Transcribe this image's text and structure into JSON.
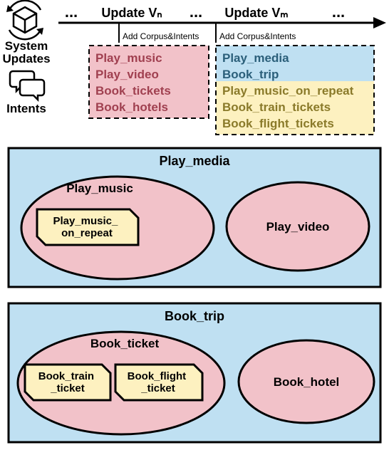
{
  "labels": {
    "system_updates": "System Updates",
    "intents": "Intents"
  },
  "timeline": {
    "dots1": "...",
    "update_n": "Update Vₙ",
    "dots2": "...",
    "update_m": "Update Vₘ",
    "dots3": "...",
    "tick_n": "Add Corpus&Intents",
    "tick_m": "Add Corpus&Intents"
  },
  "box_n": {
    "l1": "Play_music",
    "l2": "Play_video",
    "l3": "Book_tickets",
    "l4": "Book_hotels"
  },
  "box_m": {
    "top1": "Play_media",
    "top2": "Book_trip",
    "bot1": "Play_music_on_repeat",
    "bot2": "Book_train_tickets",
    "bot3": "Book_flight_tickets"
  },
  "play_media": {
    "outer": "Play_media",
    "music": "Play_music",
    "repeat": "Play_music_\non_repeat",
    "video": "Play_video"
  },
  "book_trip": {
    "outer": "Book_trip",
    "ticket": "Book_ticket",
    "train": "Book_train\n_ticket",
    "flight": "Book_flight\n_ticket",
    "hotel": "Book_hotel"
  },
  "colors": {
    "blue": "#bfe0f2",
    "pink": "#f2c2c9",
    "yellow": "#fdf1c0",
    "stroke": "#000"
  }
}
